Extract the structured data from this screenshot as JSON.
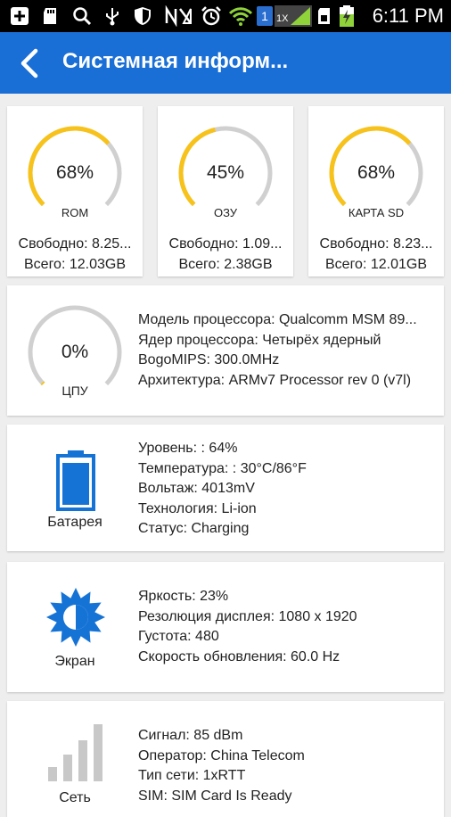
{
  "status_bar": {
    "time": "6:11 PM",
    "icons": [
      "add-icon",
      "sd-card-icon",
      "search-icon",
      "usb-icon",
      "shield-icon",
      "no-signal-icon",
      "alarm-icon",
      "wifi-icon",
      "sim1-icon",
      "signal-1x-icon",
      "sim-icon",
      "battery-charging-icon"
    ],
    "sim_badge": "1",
    "network_badge": "1X"
  },
  "app_bar": {
    "title": "Системная информ..."
  },
  "storage": [
    {
      "percent": 68,
      "percent_label": "68%",
      "name": "ROM",
      "free": "Свободно:  8.25...",
      "total": "Всего: 12.03GB"
    },
    {
      "percent": 45,
      "percent_label": "45%",
      "name": "ОЗУ",
      "free": "Свободно:  1.09...",
      "total": "Всего: 2.38GB"
    },
    {
      "percent": 68,
      "percent_label": "68%",
      "name": "КАРТА SD",
      "free": "Свободно:  8.23...",
      "total": "Всего: 12.01GB"
    }
  ],
  "cpu": {
    "percent": 0,
    "percent_label": "0%",
    "name": "ЦПУ",
    "lines": [
      "Модель процессора:  Qualcomm MSM 89...",
      "Ядер процессора: Четырёх ядерный",
      "BogoMIPS: 300.0MHz",
      "Архитектура: ARMv7 Processor rev 0 (v7l)"
    ]
  },
  "battery": {
    "name": "Батарея",
    "level": 0.64,
    "lines": [
      "Уровень: : 64%",
      "Температура: : 30°C/86°F",
      "Вольтаж: 4013mV",
      "Технология: Li-ion",
      "Статус: Charging"
    ]
  },
  "screen": {
    "name": "Экран",
    "lines": [
      "Яркость: 23%",
      "Резолюция дисплея: 1080 x 1920",
      "Густота: 480",
      "Скорость обновления: 60.0 Hz"
    ]
  },
  "network": {
    "name": "Сеть",
    "lines": [
      "Сигнал: 85 dBm",
      "Оператор: China Telecom",
      "Тип сети: 1xRTT",
      "SIM: SIM Card Is Ready"
    ]
  },
  "colors": {
    "accent": "#1a6fd6",
    "gauge_fill": "#f7c21a",
    "gauge_track": "#d0d0d0",
    "icon_blue": "#1673d6",
    "icon_gray": "#c8c8c8"
  }
}
